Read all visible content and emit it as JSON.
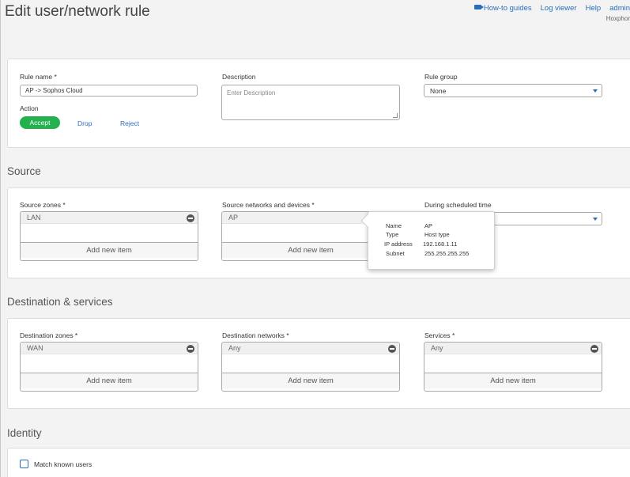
{
  "header": {
    "title": "Edit user/network rule",
    "links": {
      "guides": "How-to guides",
      "log_viewer": "Log viewer",
      "help": "Help",
      "admin": "admin"
    },
    "user_sub": "Hoxphor"
  },
  "rule": {
    "name_label": "Rule name *",
    "name_value": "AP -> Sophos Cloud",
    "description_label": "Description",
    "description_placeholder": "Enter Description",
    "group_label": "Rule group",
    "group_value": "None",
    "action_label": "Action",
    "actions": {
      "accept": "Accept",
      "drop": "Drop",
      "reject": "Reject"
    },
    "accent_color": "#22b14c"
  },
  "source": {
    "title": "Source",
    "zones_label": "Source zones *",
    "zones_item": "LAN",
    "networks_label": "Source networks and devices *",
    "networks_item": "AP",
    "schedule_label": "During scheduled time",
    "add_label": "Add new item"
  },
  "destination": {
    "title": "Destination & services",
    "zones_label": "Destination zones *",
    "zones_item": "WAN",
    "networks_label": "Destination networks *",
    "networks_item": "Any",
    "services_label": "Services *",
    "services_item": "Any",
    "add_label": "Add new item"
  },
  "identity": {
    "title": "Identity",
    "match_label": "Match known users"
  },
  "tooltip": {
    "name_key": "Name",
    "name_val": "AP",
    "type_key": "Type",
    "type_val": "Host type",
    "ip_key": "IP address",
    "ip_val": "192.168.1.11",
    "subnet_key": "Subnet",
    "subnet_val": "255.255.255.255"
  },
  "colors": {
    "link": "#2a6ebb",
    "accept": "#22b14c"
  }
}
